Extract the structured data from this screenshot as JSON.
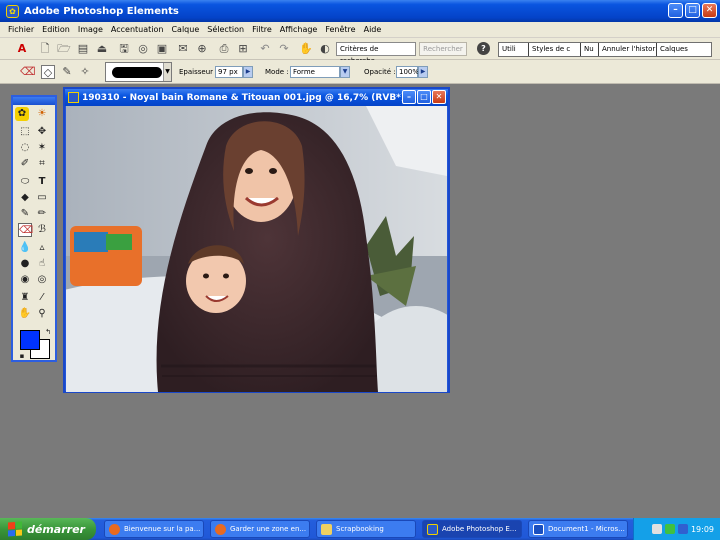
{
  "app": {
    "title": "Adobe Photoshop Elements"
  },
  "menu": [
    "Fichier",
    "Edition",
    "Image",
    "Accentuation",
    "Calque",
    "Sélection",
    "Filtre",
    "Affichage",
    "Fenêtre",
    "Aide"
  ],
  "shortcuts": {
    "search_value": "Critères de recherche",
    "search_button": "Rechercher",
    "palette_tabs": [
      "Utili",
      "Styles de c",
      "Nu",
      "Annuler l'histor",
      "Calques"
    ]
  },
  "options": {
    "size_label": "Epaisseur :",
    "size_value": "97 px",
    "mode_label": "Mode :",
    "mode_value": "Forme",
    "opacity_label": "Opacité :",
    "opacity_value": "100%"
  },
  "document": {
    "title": "190310 - Noyal bain Romane & Titouan 001.jpg @ 16,7% (RVB*)"
  },
  "colors": {
    "foreground": "#0033ff",
    "background": "#ffffff"
  },
  "taskbar": {
    "start_label": "démarrer",
    "tasks": [
      "Bienvenue sur la pa...",
      "Garder une zone en...",
      "Scrapbooking",
      "Adobe Photoshop E...",
      "Document1 - Micros..."
    ],
    "clock": "19:09"
  }
}
